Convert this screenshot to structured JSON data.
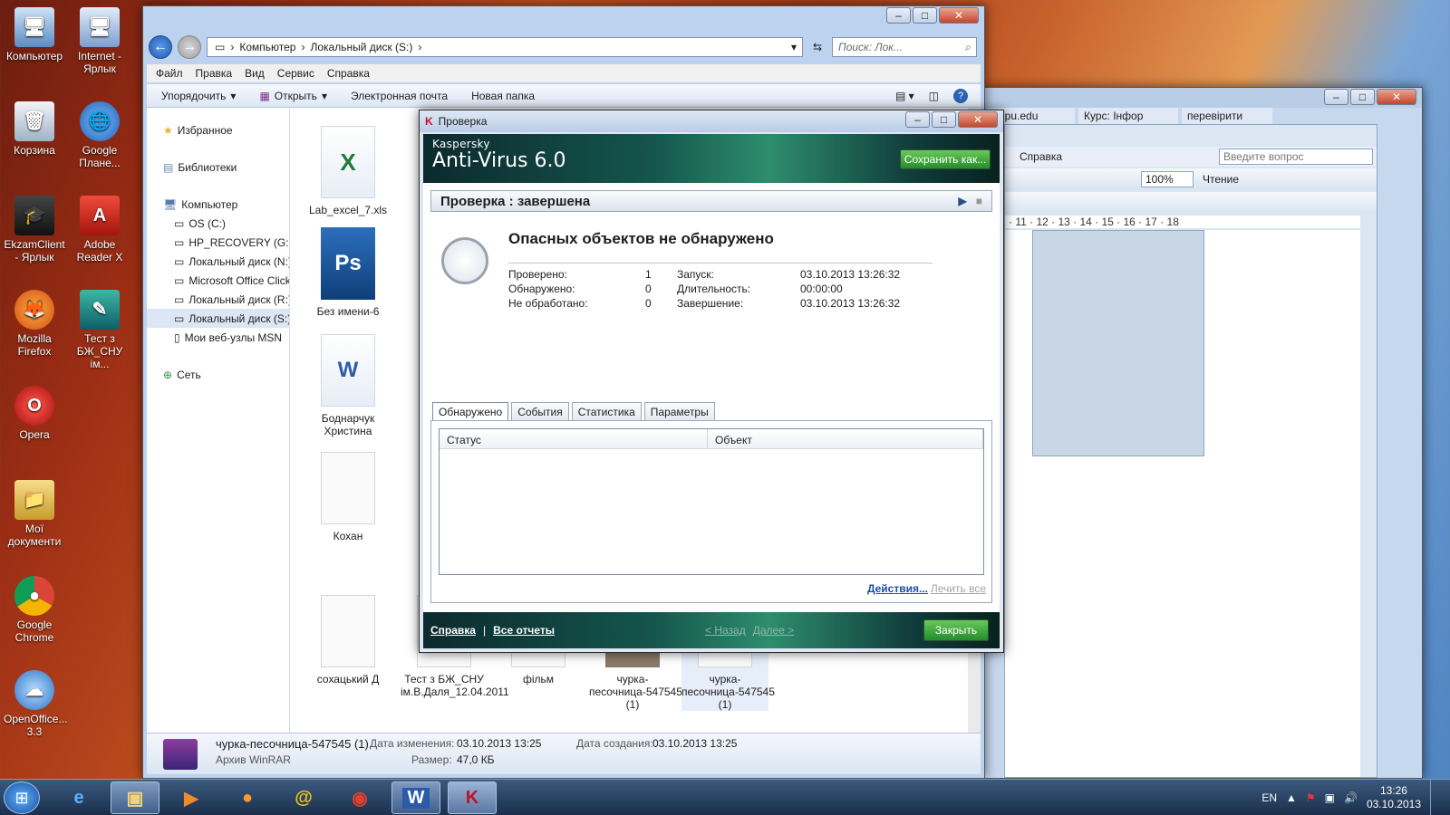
{
  "desktop": {
    "icons": [
      {
        "label_a": "Компьютер",
        "label_b": ""
      },
      {
        "label_a": "Internet -",
        "label_b": "Ярлык"
      },
      {
        "label_a": "Корзина",
        "label_b": ""
      },
      {
        "label_a": "Google",
        "label_b": "Плане..."
      },
      {
        "label_a": "EkzamClient",
        "label_b": "- Ярлык"
      },
      {
        "label_a": "Adobe",
        "label_b": "Reader X"
      },
      {
        "label_a": "Mozilla",
        "label_b": "Firefox"
      },
      {
        "label_a": "Тест з",
        "label_b": "БЖ_СНУ ім..."
      },
      {
        "label_a": "Opera",
        "label_b": ""
      },
      {
        "label_a": "Мої",
        "label_b": "документи"
      },
      {
        "label_a": "Google",
        "label_b": "Chrome"
      },
      {
        "label_a": "OpenOffice...",
        "label_b": "3.3"
      }
    ]
  },
  "explorer": {
    "breadcrumb": [
      "Компьютер",
      "Локальный диск (S:)"
    ],
    "search_placeholder": "Поиск: Лок...",
    "menu": [
      "Файл",
      "Правка",
      "Вид",
      "Сервис",
      "Справка"
    ],
    "commands": [
      "Упорядочить",
      "Открыть",
      "Электронная почта",
      "Новая папка"
    ],
    "nav": {
      "favorites": "Избранное",
      "libraries": "Библиотеки",
      "computer": "Компьютер",
      "drives": [
        "OS (C:)",
        "HP_RECOVERY (G:)",
        "Локальный диск (N:)",
        "Microsoft Office Click",
        "Локальный диск (R:)",
        "Локальный диск (S:)",
        "Мои веб-узлы MSN"
      ],
      "network": "Сеть"
    },
    "files": [
      {
        "name": "Lab_excel_7.xls",
        "icon": "excel"
      },
      {
        "name": "Без имени-6",
        "icon": "psd"
      },
      {
        "name": "Боднарчук Христина",
        "icon": "word"
      },
      {
        "name": "Кохан",
        "icon": "blank"
      },
      {
        "name": "сохацький Д",
        "icon": "blank"
      },
      {
        "name": "Тест з БЖ_СНУ ім.В.Даля_12.04.2011",
        "icon": "blank"
      },
      {
        "name": "фільм",
        "icon": "blank"
      },
      {
        "name": "чурка-песочница-547545 (1)",
        "icon": "blank"
      },
      {
        "name": "чурка-песочница-547545 (1)",
        "icon": "blank"
      }
    ],
    "details": {
      "name": "чурка-песочница-547545 (1)",
      "type": "Архив WinRAR",
      "modified_label": "Дата изменения:",
      "modified_value": "03.10.2013 13:25",
      "created_label": "Дата создания:",
      "created_value": "03.10.2013 13:25",
      "size_label": "Размер:",
      "size_value": "47,0 КБ"
    }
  },
  "background_window": {
    "tabs": [
      "r.tnpu.edu",
      "Курс: Інфор",
      "перевірити"
    ],
    "menu_help": "Справка",
    "question_placeholder": "Введите вопрос",
    "zoom": "100%",
    "reading": "Чтение",
    "ruler": "· 11 · 12 · 13 · 14 · 15 · 16 · 17 · 18"
  },
  "kaspersky": {
    "window_title": "Проверка",
    "brand_top": "Kaspersky",
    "brand_main": "Anti-Virus 6.0",
    "save_as": "Сохранить как...",
    "status": "Проверка : завершена",
    "result": "Опасных объектов не обнаружено",
    "stats": [
      {
        "label": "Проверено:",
        "value": "1"
      },
      {
        "label": "Обнаружено:",
        "value": "0"
      },
      {
        "label": "Не обработано:",
        "value": "0"
      }
    ],
    "times": [
      {
        "label": "Запуск:",
        "value": "03.10.2013 13:26:32"
      },
      {
        "label": "Длительность:",
        "value": "00:00:00"
      },
      {
        "label": "Завершение:",
        "value": "03.10.2013 13:26:32"
      }
    ],
    "tabs": [
      "Обнаружено",
      "События",
      "Статистика",
      "Параметры"
    ],
    "columns": [
      "Статус",
      "Объект"
    ],
    "actions": "Действия...",
    "cure_all": "Лечить все",
    "help": "Справка",
    "all_reports": "Все отчеты",
    "back": "< Назад",
    "next": "Далее >",
    "close": "Закрыть"
  },
  "taskbar": {
    "lang": "EN",
    "time": "13:26",
    "date": "03.10.2013"
  },
  "colors": {
    "kav_green": "#238c2b",
    "taskbar": "#1b2f4c"
  }
}
